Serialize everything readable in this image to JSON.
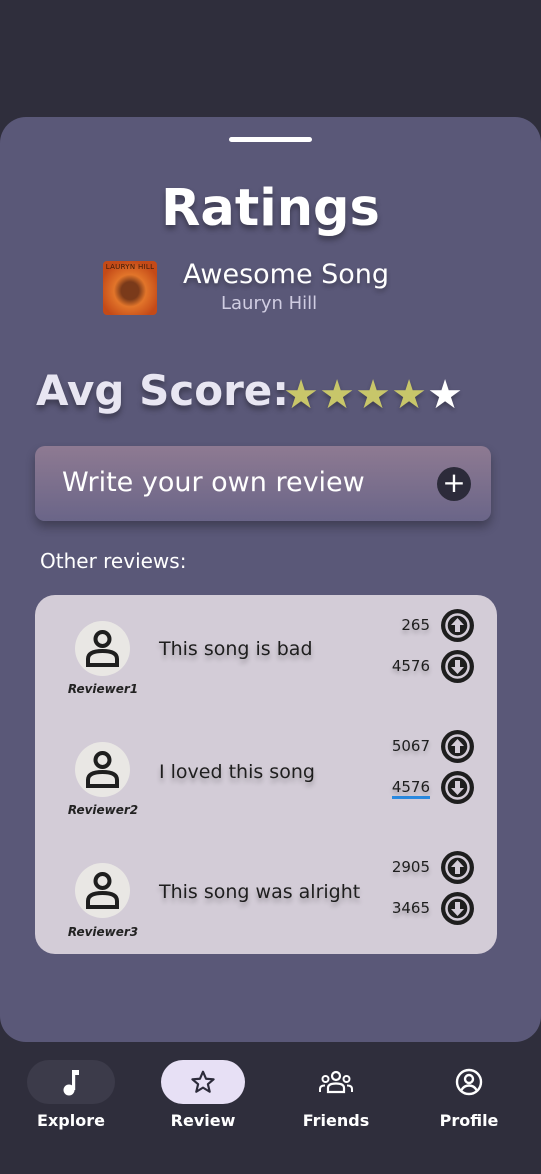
{
  "header": {
    "title": "Ratings"
  },
  "song": {
    "title": "Awesome Song",
    "artist": "Lauryn Hill",
    "album_art_caption": "LAURYN HILL"
  },
  "score": {
    "label": "Avg Score:",
    "rating": 4,
    "max": 5,
    "filled_color": "#c8c66a",
    "empty_color": "#ffffff"
  },
  "write_review": {
    "label": "Write your own review"
  },
  "other_reviews": {
    "label": "Other reviews:",
    "items": [
      {
        "reviewer": "Reviewer1",
        "text": "This song is bad",
        "upvotes": "265",
        "downvotes": "4576"
      },
      {
        "reviewer": "Reviewer2",
        "text": "I loved this song",
        "upvotes": "5067",
        "downvotes": "4576"
      },
      {
        "reviewer": "Reviewer3",
        "text": "This song was alright",
        "upvotes": "2905",
        "downvotes": "3465"
      }
    ]
  },
  "nav": {
    "items": [
      {
        "label": "Explore",
        "icon": "music-note-icon"
      },
      {
        "label": "Review",
        "icon": "star-icon",
        "active": true
      },
      {
        "label": "Friends",
        "icon": "group-icon"
      },
      {
        "label": "Profile",
        "icon": "account-circle-icon"
      }
    ]
  }
}
